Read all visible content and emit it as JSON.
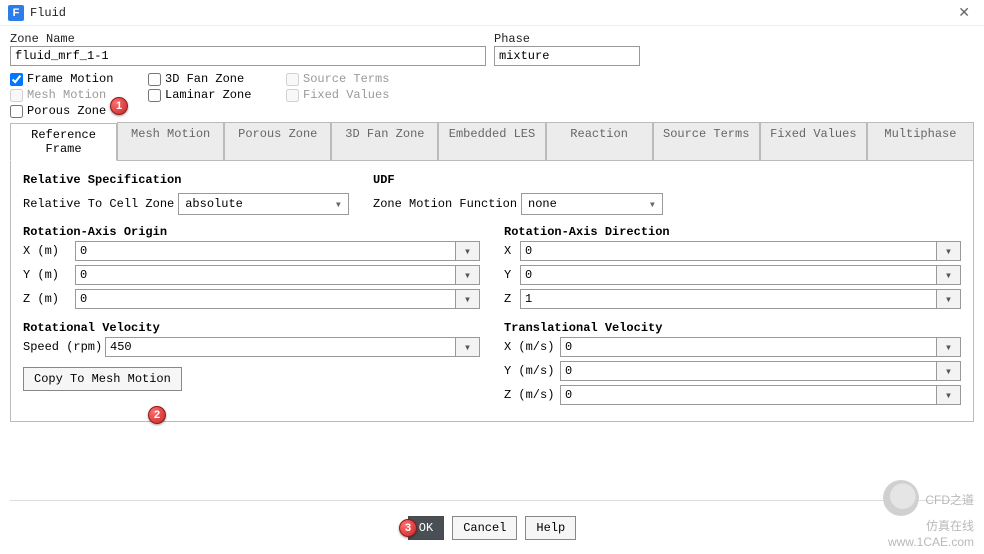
{
  "title": "Fluid",
  "zone_name_label": "Zone Name",
  "zone_name_value": "fluid_mrf_1-1",
  "phase_label": "Phase",
  "phase_value": "mixture",
  "checks": {
    "frame_motion": "Frame Motion",
    "fan_zone": "3D Fan Zone",
    "source_terms": "Source Terms",
    "mesh_motion": "Mesh Motion",
    "laminar_zone": "Laminar Zone",
    "fixed_values": "Fixed Values",
    "porous_zone": "Porous Zone"
  },
  "tabs": {
    "ref_frame": "Reference Frame",
    "mesh_motion": "Mesh Motion",
    "porous_zone": "Porous Zone",
    "fan_zone": "3D Fan Zone",
    "embedded_les": "Embedded LES",
    "reaction": "Reaction",
    "source_terms": "Source Terms",
    "fixed_values": "Fixed Values",
    "multiphase": "Multiphase"
  },
  "ref": {
    "rel_spec_label": "Relative Specification",
    "rel_cell_label": "Relative To Cell Zone",
    "rel_cell_value": "absolute",
    "udf_label": "UDF",
    "udf_fn_label": "Zone Motion Function",
    "udf_fn_value": "none",
    "axis_origin_label": "Rotation-Axis Origin",
    "axis_dir_label": "Rotation-Axis Direction",
    "xm": "X (m)",
    "ym": "Y (m)",
    "zm": "Z (m)",
    "xl": "X",
    "yl": "Y",
    "zl": "Z",
    "origin": {
      "x": "0",
      "y": "0",
      "z": "0"
    },
    "dir": {
      "x": "0",
      "y": "0",
      "z": "1"
    },
    "rotvel_label": "Rotational Velocity",
    "speed_label": "Speed (rpm)",
    "speed_value": "450",
    "copy_btn": "Copy To Mesh Motion",
    "transvel_label": "Translational Velocity",
    "xs": "X (m/s)",
    "ys": "Y (m/s)",
    "zs": "Z (m/s)",
    "trans": {
      "x": "0",
      "y": "0",
      "z": "0"
    }
  },
  "footer": {
    "ok": "OK",
    "cancel": "Cancel",
    "help": "Help"
  },
  "annot": {
    "b1": "1",
    "b2": "2",
    "b3": "3"
  },
  "watermark": {
    "l1": "CFD之道",
    "l2": "仿真在线",
    "l3": "www.1CAE.com"
  }
}
